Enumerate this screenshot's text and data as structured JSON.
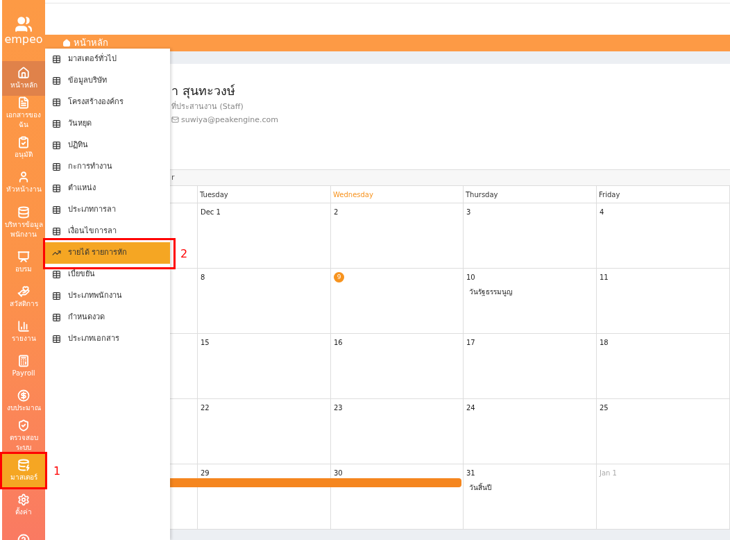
{
  "brand": {
    "name": "empeo"
  },
  "sidebar": {
    "items": [
      {
        "label": "หน้าหลัก",
        "selected": true,
        "open": false
      },
      {
        "label": "เอกสารของฉัน",
        "selected": false,
        "open": false
      },
      {
        "label": "อนุมัติ",
        "selected": false,
        "open": false
      },
      {
        "label": "หัวหน้างาน",
        "selected": false,
        "open": false
      },
      {
        "label": "บริหารข้อมูลพนักงาน",
        "selected": false,
        "open": false
      },
      {
        "label": "อบรม",
        "selected": false,
        "open": false
      },
      {
        "label": "สวัสดิการ",
        "selected": false,
        "open": false
      },
      {
        "label": "รายงาน",
        "selected": false,
        "open": false
      },
      {
        "label": "Payroll",
        "selected": false,
        "open": false
      },
      {
        "label": "งบประมาณ",
        "selected": false,
        "open": false
      },
      {
        "label": "ตรวจสอบระบบ",
        "selected": false,
        "open": false
      },
      {
        "label": "มาสเตอร์",
        "selected": false,
        "open": true
      },
      {
        "label": "ตั้งค่า",
        "selected": false,
        "open": false
      },
      {
        "selected": false,
        "open": false
      }
    ]
  },
  "breadcrumb": {
    "label": "หน้าหลัก"
  },
  "menu": {
    "items": [
      {
        "label": "มาสเตอร์ทั่วไป",
        "kind": "table",
        "selected": false
      },
      {
        "label": "ข้อมูลบริษัท",
        "kind": "table",
        "selected": false
      },
      {
        "label": "โครงสร้างองค์กร",
        "kind": "table",
        "selected": false
      },
      {
        "label": "วันหยุด",
        "kind": "table",
        "selected": false
      },
      {
        "label": "ปฏิทิน",
        "kind": "table",
        "selected": false
      },
      {
        "label": "กะการทำงาน",
        "kind": "table",
        "selected": false
      },
      {
        "label": "ตำแหน่ง",
        "kind": "table",
        "selected": false
      },
      {
        "label": "ประเภทการลา",
        "kind": "table",
        "selected": false
      },
      {
        "label": "เงื่อนไขการลา",
        "kind": "table",
        "selected": false
      },
      {
        "label": "รายได้ รายการหัก",
        "kind": "chart",
        "selected": true
      },
      {
        "label": "เบี้ยขยัน",
        "kind": "table",
        "selected": false
      },
      {
        "label": "ประเภทพนักงาน",
        "kind": "table",
        "selected": false
      },
      {
        "label": "กำหนดงวด",
        "kind": "table",
        "selected": false
      },
      {
        "label": "ประเภทเอกสาร",
        "kind": "table",
        "selected": false
      }
    ]
  },
  "profile": {
    "name": "า สุนทะวงษ์",
    "position": "ที่ประสานงาน (Staff)",
    "email": "suwiya@peakengine.com"
  },
  "calendar": {
    "title": "r",
    "columns": [
      {
        "label": "Tuesday",
        "today": false
      },
      {
        "label": "Wednesday",
        "today": true
      },
      {
        "label": "Thursday",
        "today": false
      },
      {
        "label": "Friday",
        "today": false
      }
    ],
    "weeks": [
      {
        "bar": false,
        "days": [
          {
            "date": "Dec 1",
            "today": false,
            "muted": false
          },
          {
            "date": "2",
            "today": false,
            "muted": false
          },
          {
            "date": "3",
            "today": false,
            "muted": false
          },
          {
            "date": "4",
            "today": false,
            "muted": false
          }
        ]
      },
      {
        "bar": false,
        "days": [
          {
            "date": "8",
            "today": false,
            "muted": false
          },
          {
            "date": "9",
            "today": true,
            "muted": false
          },
          {
            "date": "10",
            "today": false,
            "muted": false,
            "event": "วันรัฐธรรมนูญ"
          },
          {
            "date": "11",
            "today": false,
            "muted": false
          }
        ]
      },
      {
        "bar": false,
        "days": [
          {
            "date": "15",
            "today": false,
            "muted": false
          },
          {
            "date": "16",
            "today": false,
            "muted": false
          },
          {
            "date": "17",
            "today": false,
            "muted": false
          },
          {
            "date": "18",
            "today": false,
            "muted": false
          }
        ]
      },
      {
        "bar": false,
        "days": [
          {
            "date": "22",
            "today": false,
            "muted": false
          },
          {
            "date": "23",
            "today": false,
            "muted": false
          },
          {
            "date": "24",
            "today": false,
            "muted": false
          },
          {
            "date": "25",
            "today": false,
            "muted": false
          }
        ]
      },
      {
        "bar": true,
        "days": [
          {
            "date": "29",
            "today": false,
            "muted": false
          },
          {
            "date": "30",
            "today": false,
            "muted": false
          },
          {
            "date": "31",
            "today": false,
            "muted": false,
            "event": "วันสิ้นปี"
          },
          {
            "date": "Jan 1",
            "today": false,
            "muted": true
          }
        ]
      }
    ]
  },
  "annotations": [
    {
      "label": "1"
    },
    {
      "label": "2"
    }
  ]
}
